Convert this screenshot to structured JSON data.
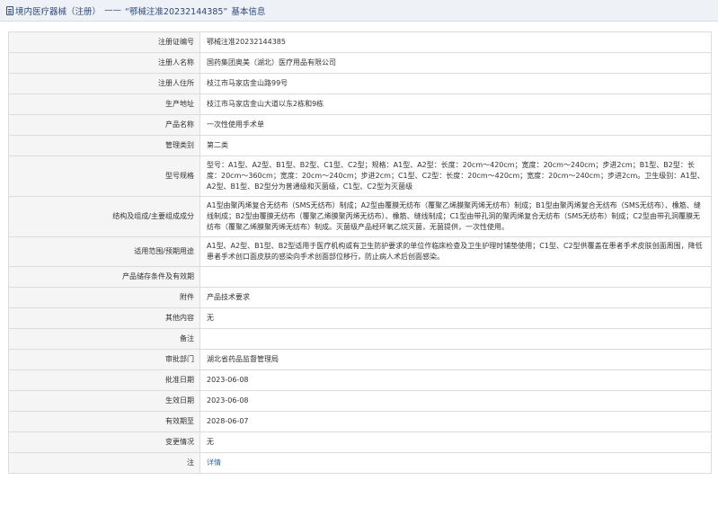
{
  "header": {
    "crumb_link": "境内医疗器械（注册）",
    "separator": "——",
    "title_quote": "“鄂械注准20232144385”",
    "title_suffix": "基本信息"
  },
  "rows": [
    {
      "label": "注册证编号",
      "value": "鄂械注准20232144385"
    },
    {
      "label": "注册人名称",
      "value": "国药集团奥美（湖北）医疗用品有限公司"
    },
    {
      "label": "注册人住所",
      "value": "枝江市马家店金山路99号"
    },
    {
      "label": "生产地址",
      "value": "枝江市马家店金山大道以东2栋和9栋"
    },
    {
      "label": "产品名称",
      "value": "一次性使用手术单"
    },
    {
      "label": "管理类别",
      "value": "第二类"
    },
    {
      "label": "型号规格",
      "value": "型号：A1型、A2型、B1型、B2型、C1型、C2型；规格：A1型、A2型：长度：20cm～420cm；宽度：20cm～240cm；步进2cm；B1型、B2型：长度：20cm～360cm；宽度：20cm～240cm；步进2cm；C1型、C2型：长度：20cm～420cm；宽度：20cm～240cm；步进2cm。卫生级别：A1型、A2型、B1型、B2型分为普通级和灭菌级，C1型、C2型为灭菌级"
    },
    {
      "label": "结构及组成/主要组成成分",
      "value": "A1型由聚丙烯复合无纺布（SMS无纺布）制成；A2型由覆膜无纺布（覆聚乙烯膜聚丙烯无纺布）制成；B1型由聚丙烯复合无纺布（SMS无纺布）、橡筋、缝线制成；B2型由覆膜无纺布（覆聚乙烯膜聚丙烯无纺布）、橡筋、缝线制成；C1型由带孔洞的聚丙烯复合无纺布（SMS无纺布）制成；C2型由带孔洞覆膜无纺布（覆聚乙烯膜聚丙烯无纺布）制成。灭菌级产品经环氧乙烷灭菌，无菌提供，一次性使用。"
    },
    {
      "label": "适用范围/预期用途",
      "value": "A1型、A2型、B1型、B2型适用于医疗机构或有卫生防护要求的单位作临床检查及卫生护理时铺垫使用；C1型、C2型供覆盖在患者手术皮肤创面周围，降低患者手术创口面皮肤的感染向手术创面部位移行，防止病人术后创面感染。"
    },
    {
      "label": "产品储存条件及有效期",
      "value": ""
    },
    {
      "label": "附件",
      "value": "产品技术要求"
    },
    {
      "label": "其他内容",
      "value": "无"
    },
    {
      "label": "备注",
      "value": ""
    },
    {
      "label": "审批部门",
      "value": "湖北省药品监督管理局"
    },
    {
      "label": "批准日期",
      "value": "2023-06-08"
    },
    {
      "label": "生效日期",
      "value": "2023-06-08"
    },
    {
      "label": "有效期至",
      "value": "2028-06-07"
    },
    {
      "label": "变更情况",
      "value": "无"
    },
    {
      "label": "注",
      "value": "详情"
    }
  ]
}
